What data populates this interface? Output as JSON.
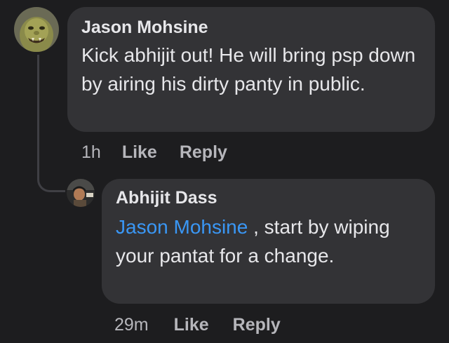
{
  "comments": [
    {
      "author": "Jason Mohsine",
      "text": "Kick abhijit out! He will bring psp down by airing his dirty panty in public.",
      "time": "1h",
      "like_label": "Like",
      "reply_label": "Reply",
      "avatar_icon": "ogre-avatar-icon"
    }
  ],
  "reply": {
    "author": "Abhijit Dass",
    "mention": "Jason Mohsine",
    "text": " , start by wiping your pantat for a change.",
    "time": "29m",
    "like_label": "Like",
    "reply_label": "Reply",
    "avatar_icon": "photo-avatar-icon"
  },
  "colors": {
    "background": "#1d1d1f",
    "bubble": "#333336",
    "text": "#e7e7ea",
    "meta": "#b6b6bb",
    "mention": "#3a97f5"
  }
}
